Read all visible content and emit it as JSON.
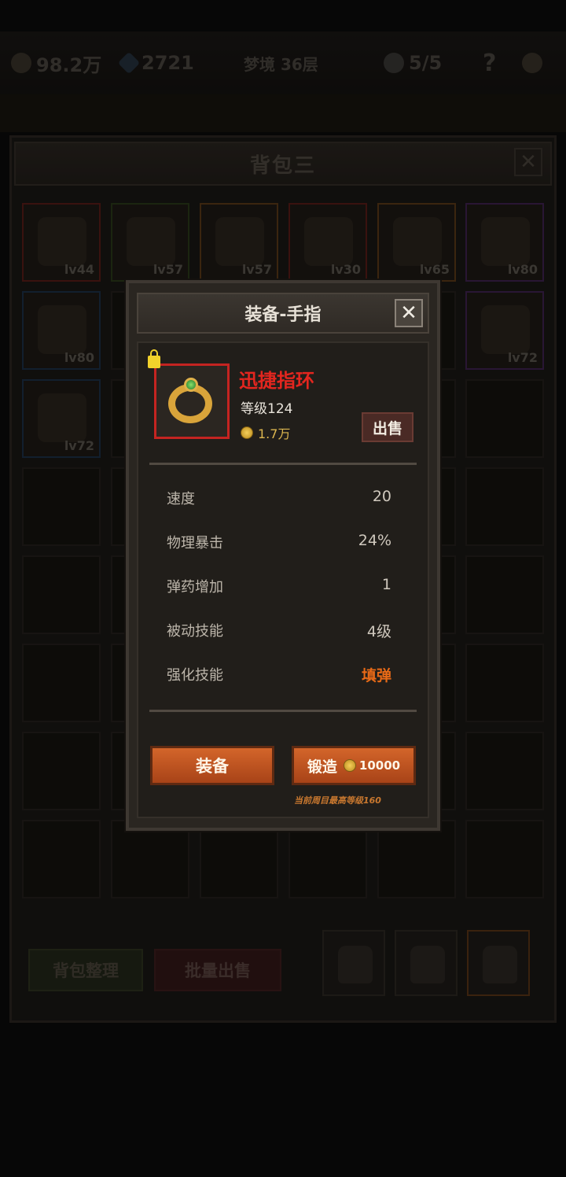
{
  "top_bar": {
    "gold": "98.2万",
    "gems": "2721",
    "stage": "梦境 36层",
    "lives": "5/5",
    "help": "?"
  },
  "bag": {
    "title": "背包三",
    "close": "✕",
    "slots": [
      {
        "level": "lv44",
        "rarity": "red"
      },
      {
        "level": "lv57",
        "rarity": "green"
      },
      {
        "level": "lv57",
        "rarity": "orange"
      },
      {
        "level": "lv30",
        "rarity": "red"
      },
      {
        "level": "lv65",
        "rarity": "orange"
      },
      {
        "level": "lv80",
        "rarity": "purple"
      },
      {
        "level": "lv80",
        "rarity": "blue"
      },
      {
        "level": "lv72",
        "rarity": "purple"
      },
      {
        "level": "lv72",
        "rarity": "blue"
      }
    ],
    "sort_label": "背包整理",
    "bulk_sell_label": "批量出售"
  },
  "dialog": {
    "title": "装备-手指",
    "close": "✕",
    "item": {
      "name": "迅捷指环",
      "level": "等级124",
      "price": "1.7万",
      "icon": "ring-icon",
      "locked": true
    },
    "sell_label": "出售",
    "stats": [
      {
        "name": "速度",
        "value": "20"
      },
      {
        "name": "物理暴击",
        "value": "24%"
      },
      {
        "name": "弹药增加",
        "value": "1"
      },
      {
        "name": "被动技能",
        "value": "4级"
      },
      {
        "name": "强化技能",
        "value": "填弹"
      }
    ],
    "equip_label": "装备",
    "forge_label": "锻造",
    "forge_cost": "10000",
    "max_note": "当前周目最高等级160"
  },
  "colors": {
    "item_name": "#e3261f",
    "highlight_stat": "#e86a17",
    "button": "#c0562a"
  }
}
